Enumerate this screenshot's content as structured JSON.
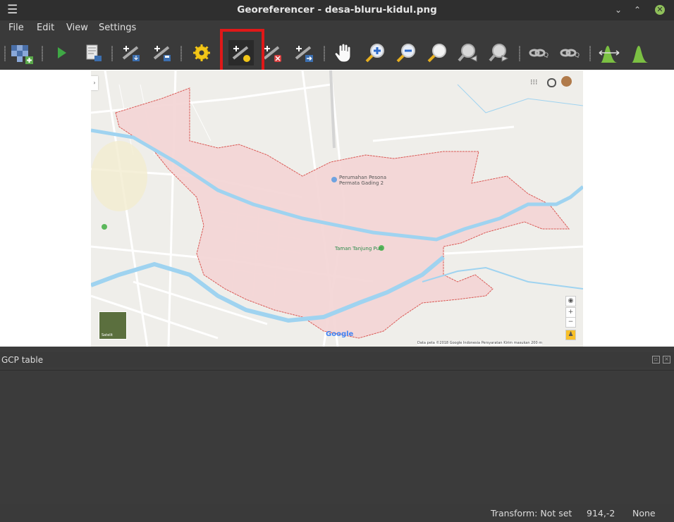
{
  "window": {
    "title": "Georeferencer - desa-bluru-kidul.png",
    "menu_icon": "hamburger-icon",
    "controls": [
      "minimize-icon",
      "restore-icon",
      "close-icon"
    ]
  },
  "menu": {
    "file": "File",
    "edit": "Edit",
    "view": "View",
    "settings": "Settings"
  },
  "toolbar": {
    "buttons": [
      "open-raster-icon",
      "start-georeferencing-icon",
      "generate-gdal-script-icon",
      "load-gcp-points-icon",
      "save-gcp-points-icon",
      "transformation-settings-icon",
      "add-point-icon",
      "delete-point-icon",
      "move-gcp-point-icon",
      "pan-icon",
      "zoom-in-icon",
      "zoom-out-icon",
      "zoom-to-layer-icon",
      "zoom-last-icon",
      "zoom-next-icon",
      "link-georeferencer-to-qgis-icon",
      "link-qgis-to-georeferencer-icon",
      "full-histogram-stretch-icon",
      "local-histogram-stretch-icon"
    ],
    "highlight_color": "#e01818"
  },
  "map": {
    "google_label": "Google",
    "poi_1": "Perumahan Pesona Permata Gading 2",
    "poi_2": "Taman Tanjung Puri",
    "satellite_label": "Satelit",
    "footer": "Data peta ©2018 Google   Indonesia   Persyaratan   Kirim masukan   200 m",
    "area_fill": "#f4d6d6",
    "area_border": "#d9534f",
    "river_color": "#9fd3f0"
  },
  "gcp": {
    "title": "GCP table"
  },
  "status": {
    "transform": "Transform: Not set",
    "coords": "914,-2",
    "crs": "None"
  }
}
